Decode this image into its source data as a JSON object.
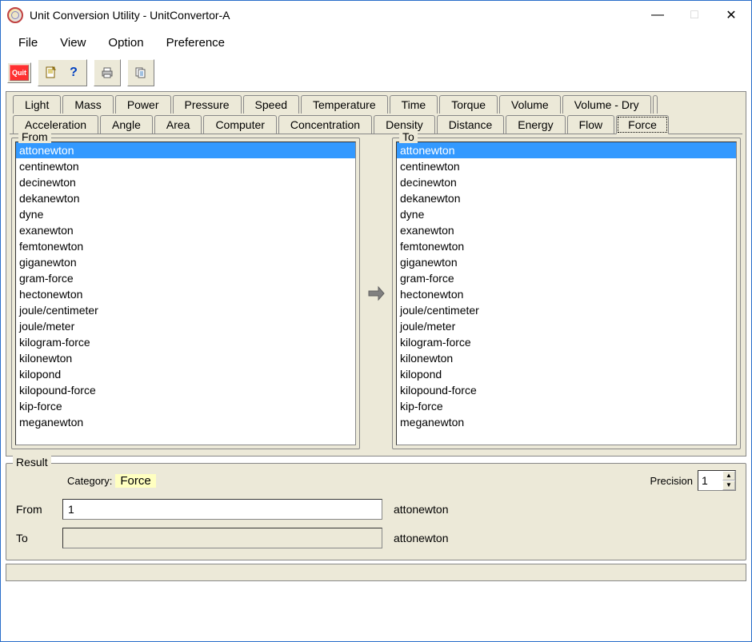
{
  "window": {
    "title": "Unit Conversion Utility - UnitConvertor-A"
  },
  "menu": {
    "items": [
      "File",
      "View",
      "Option",
      "Preference"
    ]
  },
  "toolbar": {
    "quit": "Quit"
  },
  "tabs_row1": [
    "Light",
    "Mass",
    "Power",
    "Pressure",
    "Speed",
    "Temperature",
    "Time",
    "Torque",
    "Volume",
    "Volume - Dry"
  ],
  "tabs_row2": [
    "Acceleration",
    "Angle",
    "Area",
    "Computer",
    "Concentration",
    "Density",
    "Distance",
    "Energy",
    "Flow",
    "Force"
  ],
  "active_tab": "Force",
  "from": {
    "label": "From",
    "selected": "attonewton",
    "items": [
      "attonewton",
      "centinewton",
      "decinewton",
      "dekanewton",
      "dyne",
      "exanewton",
      "femtonewton",
      "giganewton",
      "gram-force",
      "hectonewton",
      "joule/centimeter",
      "joule/meter",
      "kilogram-force",
      "kilonewton",
      "kilopond",
      "kilopound-force",
      "kip-force",
      "meganewton"
    ]
  },
  "to": {
    "label": "To",
    "selected": "attonewton",
    "items": [
      "attonewton",
      "centinewton",
      "decinewton",
      "dekanewton",
      "dyne",
      "exanewton",
      "femtonewton",
      "giganewton",
      "gram-force",
      "hectonewton",
      "joule/centimeter",
      "joule/meter",
      "kilogram-force",
      "kilonewton",
      "kilopond",
      "kilopound-force",
      "kip-force",
      "meganewton"
    ]
  },
  "result": {
    "label": "Result",
    "category_label": "Category:",
    "category_value": "Force",
    "precision_label": "Precision",
    "precision_value": "1",
    "from_label": "From",
    "from_value": "1",
    "from_unit": "attonewton",
    "to_label": "To",
    "to_value": "",
    "to_unit": "attonewton"
  }
}
